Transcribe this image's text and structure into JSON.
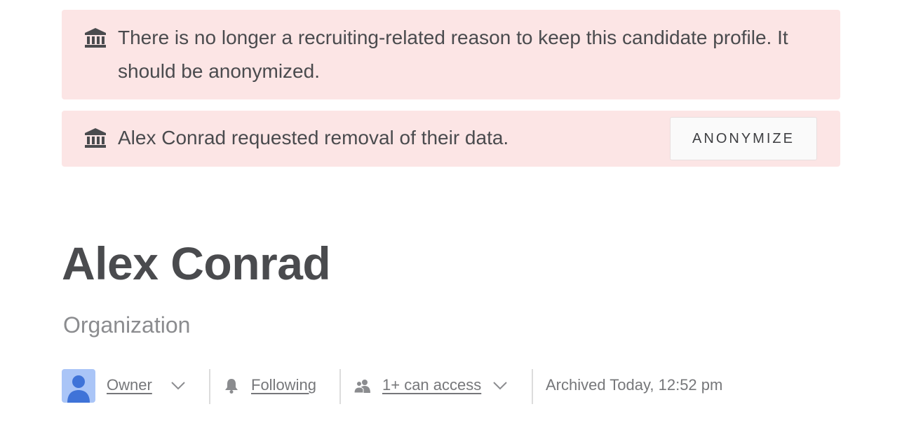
{
  "alerts": [
    {
      "icon": "bank-icon",
      "text": "There is no longer a recruiting-related reason to keep this candidate profile. It should be anonymized."
    },
    {
      "icon": "bank-icon",
      "text": "Alex Conrad requested removal of their data.",
      "action_label": "ANONYMIZE"
    }
  ],
  "profile": {
    "name": "Alex Conrad",
    "organization": "Organization"
  },
  "meta": {
    "owner_label": "Owner",
    "following_label": "Following",
    "access_label": "1+ can access",
    "archived_text": "Archived Today, 12:52 pm"
  },
  "colors": {
    "alert_background": "#fce5e5",
    "avatar_background": "#aac5f7",
    "avatar_figure": "#3f73d8"
  }
}
